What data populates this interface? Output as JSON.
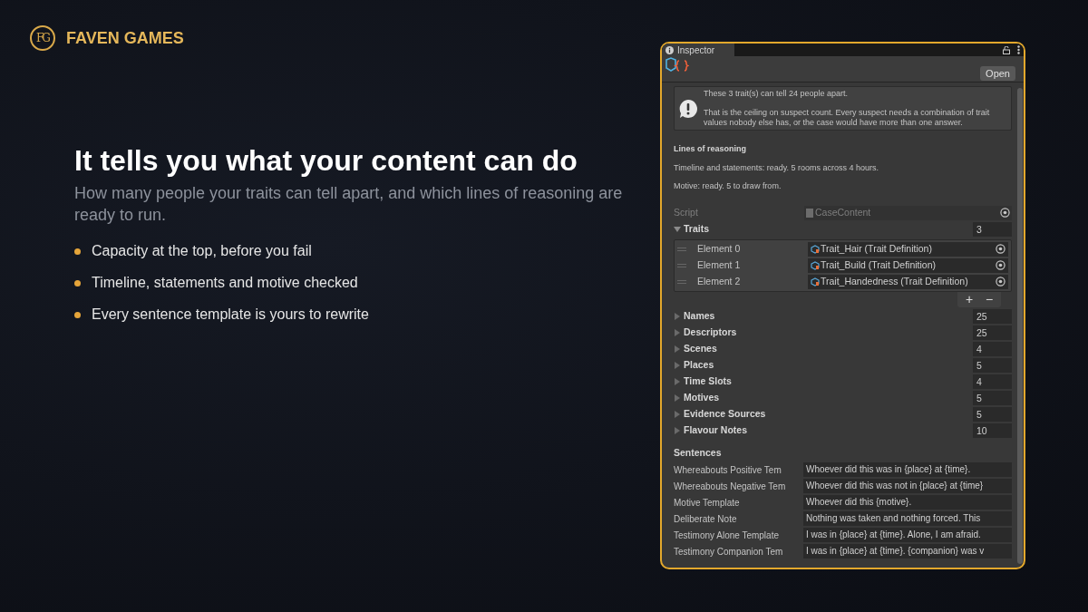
{
  "brand": {
    "monogram": "FG",
    "name": "FAVEN GAMES"
  },
  "headline": "It tells you what your content can do",
  "subtitle": "How many people your traits can tell apart, and which lines of reasoning are ready to run.",
  "bullets": [
    "Capacity at the top, before you fail",
    "Timeline, statements and motive checked",
    "Every sentence template is yours to rewrite"
  ],
  "inspector": {
    "tab": "Inspector",
    "open_button": "Open",
    "help_box": {
      "lines": [
        "These 3 trait(s) can tell 24 people apart.",
        "That is the ceiling on suspect count. Every suspect needs a combination of trait values nobody else has, or the case would have more than one answer."
      ]
    },
    "reasoning": {
      "title": "Lines of reasoning",
      "lines": [
        "Timeline and statements: ready. 5 rooms across 4 hours.",
        "Motive: ready. 5 to draw from."
      ]
    },
    "script": {
      "label": "Script",
      "value": "CaseContent"
    },
    "traits": {
      "label": "Traits",
      "count": "3",
      "expanded": true,
      "add": "+",
      "remove": "−",
      "elements": [
        {
          "label": "Element 0",
          "value": "Trait_Hair (Trait Definition)"
        },
        {
          "label": "Element 1",
          "value": "Trait_Build (Trait Definition)"
        },
        {
          "label": "Element 2",
          "value": "Trait_Handedness (Trait Definition)"
        }
      ]
    },
    "collections": [
      {
        "label": "Names",
        "count": "25",
        "expanded": false
      },
      {
        "label": "Descriptors",
        "count": "25",
        "expanded": false
      },
      {
        "label": "Scenes",
        "count": "4",
        "expanded": false
      },
      {
        "label": "Places",
        "count": "5",
        "expanded": false
      },
      {
        "label": "Time Slots",
        "count": "4",
        "expanded": false
      },
      {
        "label": "Motives",
        "count": "5",
        "expanded": false
      },
      {
        "label": "Evidence Sources",
        "count": "5",
        "expanded": false
      },
      {
        "label": "Flavour Notes",
        "count": "10",
        "expanded": false
      }
    ],
    "sentences": {
      "title": "Sentences",
      "fields": [
        {
          "label": "Whereabouts Positive Tem",
          "value": "Whoever did this was in {place} at {time}."
        },
        {
          "label": "Whereabouts Negative Tem",
          "value": "Whoever did this was not in {place} at {time}"
        },
        {
          "label": "Motive Template",
          "value": "Whoever did this {motive}."
        },
        {
          "label": "Deliberate Note",
          "value": "Nothing was taken and nothing forced. This"
        },
        {
          "label": "Testimony Alone Template",
          "value": "I was in {place} at {time}. Alone, I am afraid."
        },
        {
          "label": "Testimony Companion Tem",
          "value": "I was in {place} at {time}. {companion} was v"
        }
      ]
    }
  }
}
